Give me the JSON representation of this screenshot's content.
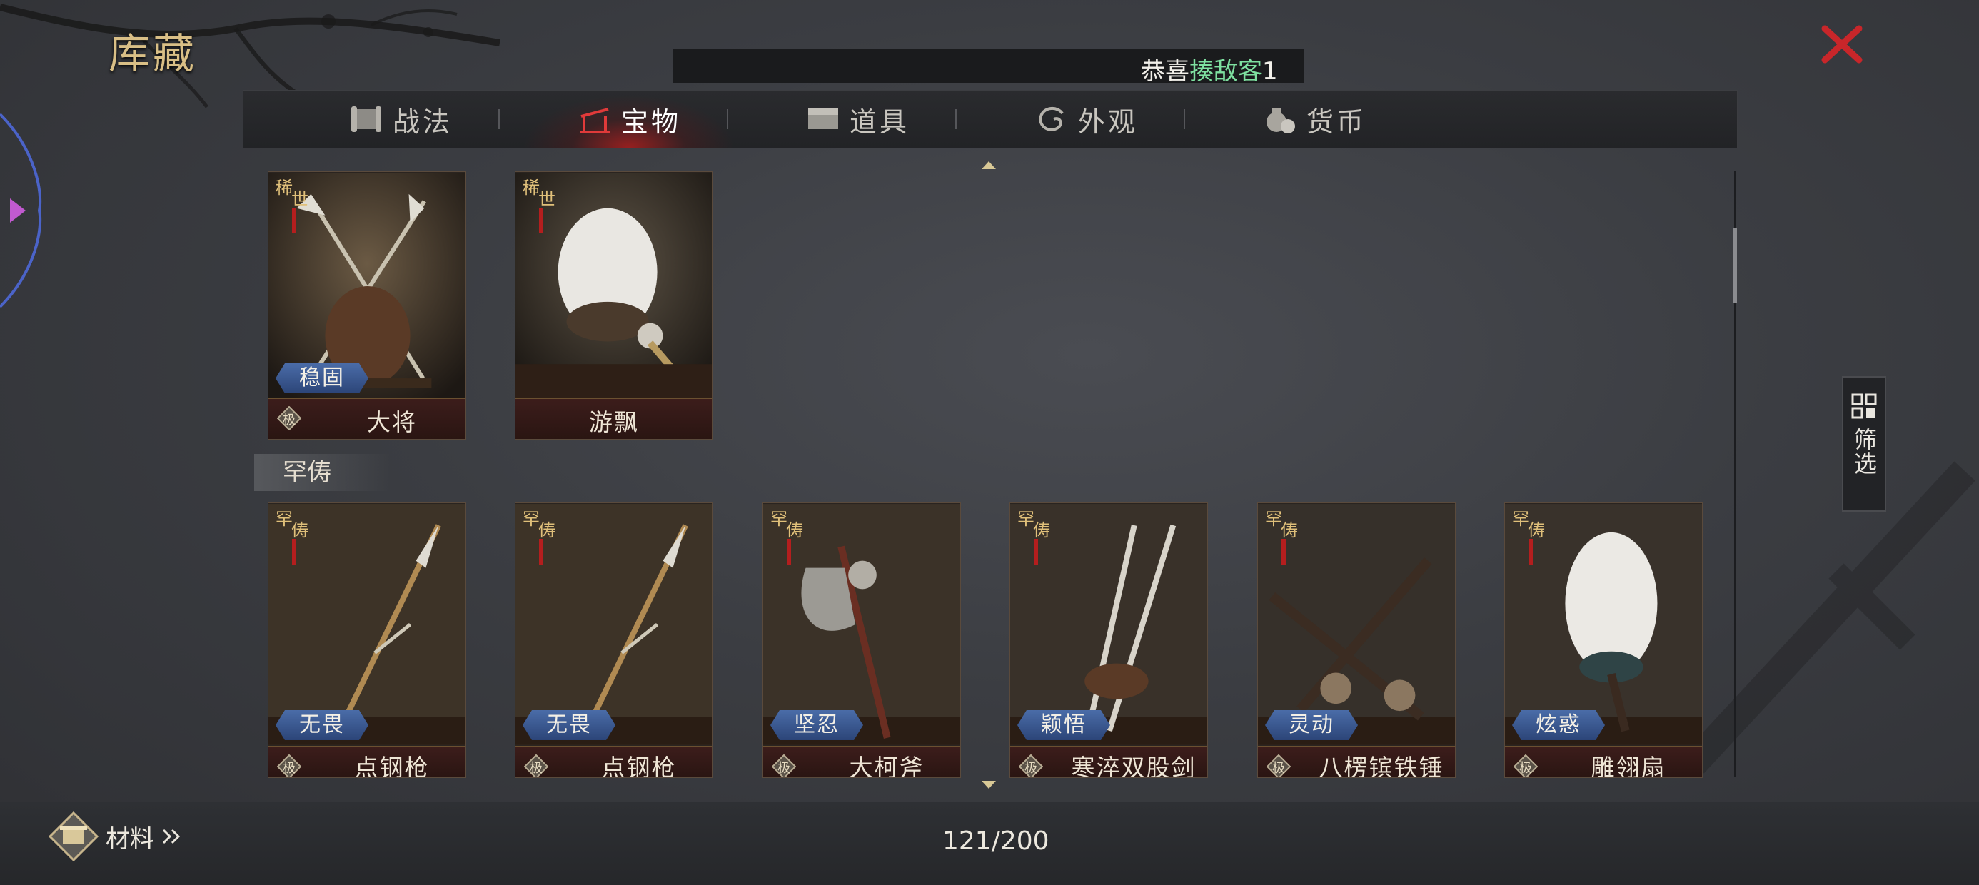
{
  "header": {
    "title": "库藏",
    "ticker": {
      "prefix": "恭喜",
      "highlight": "揍敌客",
      "suffix": "1"
    }
  },
  "tabs": [
    {
      "label": "战法",
      "icon": "scroll-icon",
      "active": false
    },
    {
      "label": "宝物",
      "icon": "weapon-rack-icon",
      "active": true
    },
    {
      "label": "道具",
      "icon": "chest-icon",
      "active": false
    },
    {
      "label": "外观",
      "icon": "swirl-icon",
      "active": false
    },
    {
      "label": "货币",
      "icon": "money-bag-icon",
      "active": false
    }
  ],
  "top_cards": [
    {
      "name": "大将",
      "trait": "稳固",
      "rarity": "稀世",
      "grade": "极",
      "art": "crossed-halberds"
    },
    {
      "name": "游飘",
      "trait": "",
      "rarity": "稀世",
      "grade": "",
      "art": "feather-fan"
    }
  ],
  "section": {
    "label": "罕俦"
  },
  "section_cards": [
    {
      "name": "点钢枪",
      "trait": "无畏",
      "rarity": "罕俦",
      "grade": "极",
      "art": "spear"
    },
    {
      "name": "点钢枪",
      "trait": "无畏",
      "rarity": "罕俦",
      "grade": "极",
      "art": "spear"
    },
    {
      "name": "大柯斧",
      "trait": "坚忍",
      "rarity": "罕俦",
      "grade": "极",
      "art": "axe"
    },
    {
      "name": "寒淬双股剑",
      "trait": "颖悟",
      "rarity": "罕俦",
      "grade": "极",
      "art": "twin-swords"
    },
    {
      "name": "八楞镔铁锤",
      "trait": "灵动",
      "rarity": "罕俦",
      "grade": "极",
      "art": "crossed-maces"
    },
    {
      "name": "雕翎扇",
      "trait": "炫惑",
      "rarity": "罕俦",
      "grade": "极",
      "art": "feather-fan"
    }
  ],
  "filter": {
    "label": "筛选"
  },
  "footer": {
    "materials_label": "材料",
    "count": "121/200"
  },
  "colors": {
    "accent_red": "#c8262a",
    "title_gold": "#d9bf86",
    "trait_blue": "#3a5a94",
    "ticker_green": "#7ee0a0"
  }
}
